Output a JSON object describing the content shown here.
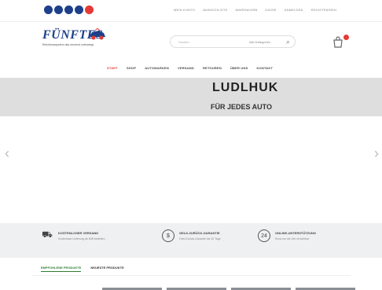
{
  "topbar": {
    "links": [
      "MEIN KONTO",
      "WUNSCHLISTE",
      "WARENKORB",
      "KASSE",
      "ANMELDEN",
      "REGISTRIEREN"
    ]
  },
  "logo": {
    "word": "FÜNFTES",
    "tagline": "Reichtumssystem das rennend unterwegs"
  },
  "search": {
    "placeholder": "Suchen",
    "category": "Alle Kategorien"
  },
  "nav": {
    "items": [
      "START",
      "SHOP",
      "AUTOMARKEN",
      "VERSAND",
      "RETOUREN",
      "ÜBER UNS",
      "KONTAKT"
    ],
    "active": 0
  },
  "hero": {
    "headline": "LUDLHUK",
    "subline": "FÜR JEDES AUTO",
    "prev": "‹",
    "next": "›"
  },
  "features": [
    {
      "title": "KOSTENLOSER VERSAND",
      "subtitle": "Kostenlose Lieferung ab 50€ bestellen"
    },
    {
      "title": "GELD-ZURÜCK-GARANTIE",
      "subtitle": "Geld-Zurück-Garantie bis 30 Tage"
    },
    {
      "title": "ONLINE-UNTERSTÜTZUNG",
      "subtitle": "Rund um die Uhr erreichbar"
    }
  ],
  "product_tabs": {
    "items": [
      "EMPFOHLENE PRODUKTE",
      "NEUESTE PRODUKTE"
    ],
    "active": 0
  },
  "colors": {
    "brand": "#1e3f8a",
    "accent": "#e63935",
    "tab_active": "#2e7d32"
  }
}
